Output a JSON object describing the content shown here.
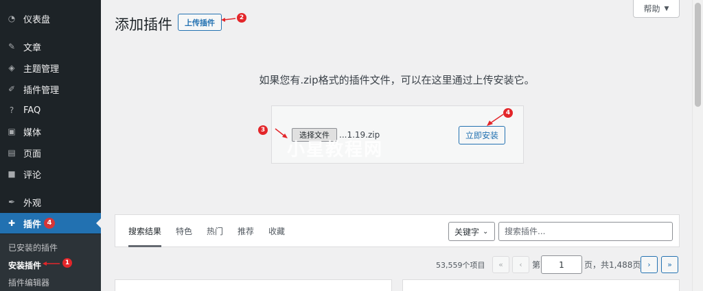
{
  "sidebar": {
    "items": [
      {
        "label": "仪表盘",
        "icon": "dashboard-icon"
      },
      {
        "label": "文章",
        "icon": "pin-icon"
      },
      {
        "label": "主题管理",
        "icon": "tag-icon"
      },
      {
        "label": "插件管理",
        "icon": "brush-icon"
      },
      {
        "label": "FAQ",
        "icon": "question-icon"
      },
      {
        "label": "媒体",
        "icon": "media-icon"
      },
      {
        "label": "页面",
        "icon": "page-icon"
      },
      {
        "label": "评论",
        "icon": "comment-icon"
      },
      {
        "label": "外观",
        "icon": "appearance-icon"
      },
      {
        "label": "插件",
        "icon": "plugin-icon",
        "badge": "4"
      }
    ],
    "submenu": [
      "已安装的插件",
      "安装插件",
      "插件编辑器"
    ]
  },
  "header": {
    "title": "添加插件",
    "upload_label": "上传插件",
    "help_label": "帮助"
  },
  "upload": {
    "instruction": "如果您有.zip格式的插件文件，可以在这里通过上传安装它。",
    "choose_label": "选择文件",
    "file_name": "...1.19.zip",
    "install_label": "立即安装"
  },
  "watermark": "小星教程网",
  "filter": {
    "tabs": [
      "搜索结果",
      "特色",
      "热门",
      "推荐",
      "收藏"
    ],
    "select_value": "关键字",
    "search_placeholder": "搜索插件..."
  },
  "pagination": {
    "items_count": "53,559个项目",
    "first": "«",
    "prev": "‹",
    "page_prefix": "第",
    "current_page": "1",
    "page_suffix": "页，共1,488页",
    "next": "›",
    "last": "»"
  },
  "annotations": [
    "1",
    "2",
    "3",
    "4"
  ],
  "colors": {
    "accent": "#2271b1",
    "sidebar": "#1d2327",
    "marker": "#e3262a"
  }
}
